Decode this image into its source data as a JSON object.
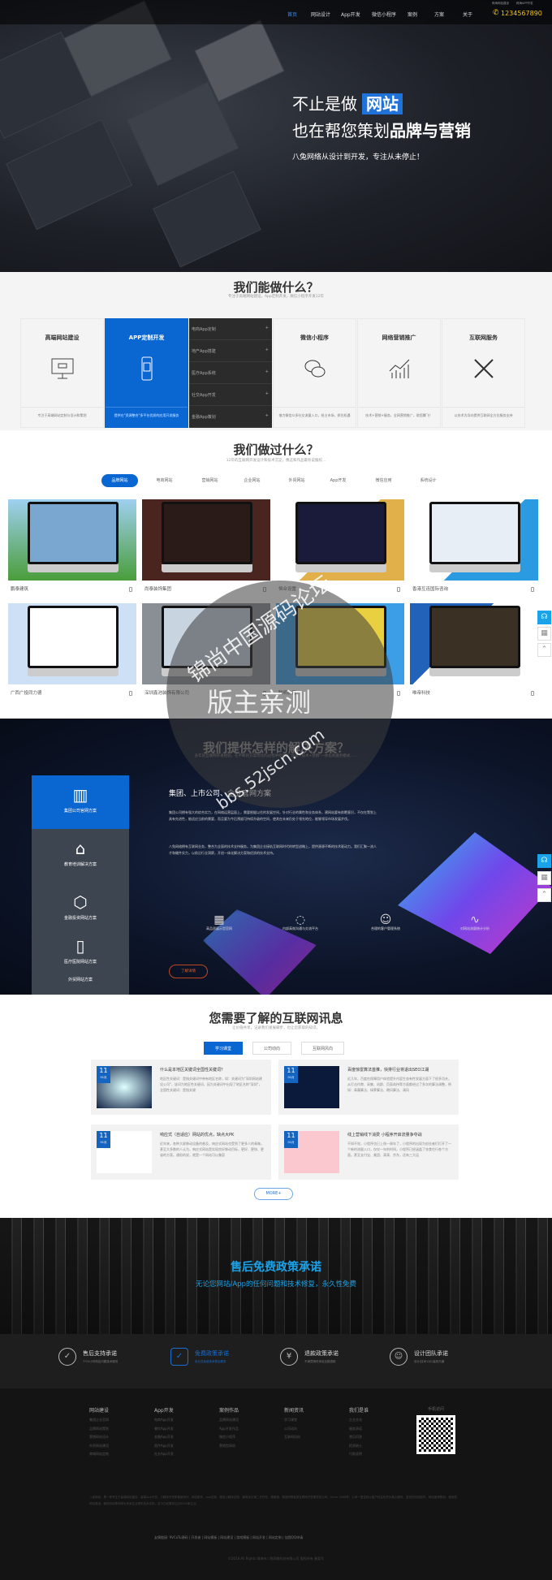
{
  "nav": {
    "items": [
      "首页",
      "网站设计",
      "App开发",
      "微信小程序",
      "案例",
      "方案",
      "关于"
    ],
    "top_links": [
      "珠海网站建设",
      "珠海APP开发"
    ],
    "phone": "1234567890",
    "accent": "#1f73d8"
  },
  "hero": {
    "line1": "不止是做",
    "highlight": "网站",
    "line2_a": "也在帮您策划",
    "line2_b": "品牌与营销",
    "slogan": "八兔网络从设计到开发，专注从未停止！"
  },
  "services": {
    "title": "我们能做什么？",
    "subtitle": "专注于高端网站建设，App定制开发，微信小程序开发12年",
    "items": [
      {
        "title": "高端网站建设",
        "desc": "专注于高端网站定制与设计和策划"
      },
      {
        "title": "APP定制开发",
        "desc": "提供在\"资源整合\"多平台优质的应用开发服务"
      },
      {
        "title": "微信小程序",
        "desc": "借力微信众多社交流量入口，抢占市场，抓住机遇"
      },
      {
        "title": "网络营销推广",
        "desc": "技术+营销+服务，全网营销推广，助您腾飞！"
      },
      {
        "title": "互联网服务",
        "desc": "以技术为导向提供互联网全方位服务支持"
      }
    ],
    "app_menu": [
      "电商App定制",
      "地产App搭建",
      "医疗App系统",
      "社交App开发",
      "金融App策划"
    ]
  },
  "portfolio": {
    "title": "我们做过什么？",
    "subtitle": "12年的互联网开发设计和技术沉淀，像这和作品最有说服权...",
    "tabs": [
      "品牌网站",
      "电商网站",
      "营销网站",
      "企业网站",
      "外贸网站",
      "App开发",
      "微信应用",
      "系统设计"
    ],
    "cases": [
      "鹏泰建筑",
      "尚泰装饰集团",
      "恒众设置",
      "香港互连国际咨询",
      "广西广投同力德",
      "深圳鑫池装饰有限公司",
      "聪明教育",
      "唯帝科技"
    ]
  },
  "solutions": {
    "title": "我们提供怎样的解决方案？",
    "subtitle": "多年的互联网开发经验，在不断的方案优化的过程中搭建了\"创意+技术+营销\"一体化的服务模式……",
    "nav": [
      "集团公司官网方案",
      "教育培训解决方案",
      "金融投资网站方案",
      "医疗医院网站方案",
      "外贸网站方案"
    ],
    "heading": "集团、上市公司、企业官网方案",
    "para1": "集团公司拥有强大的综合实力，在网络运营层面上，需要根据以往的发展空间，针对行业的属性和业务体系，建网站要有前瞻意识，不仅在策划上具有先进性，能适应当前的需要，而且要为今后预留可持续升级的空间，使其在未来仍处于领先地位，能够领导市场发展步伐。",
    "para2": "八兔网络拥有互联网业务，整合为全面的技术支持服务。为集团企业接轨互联网时代的转型战略上，提供源源不断的技术驱动力。我们汇聚一流人才和硬件实力，以前沿行业洞察，开创一体化解决方案和优质的技术支持。",
    "features": [
      "高品质展示型官网",
      "内部高效沟通与交流平台",
      "合理的客户管理系统",
      "对网站流量统计分析"
    ],
    "button": "了解详情",
    "highlight": "#1565c0"
  },
  "news": {
    "title": "您需要了解的互联网讯息",
    "subtitle": "让价值共享，记录我们发展脚步，也让您获取的知识。",
    "tabs": [
      "学习课堂",
      "公司动向",
      "互联网风向"
    ],
    "items": [
      {
        "day": "11",
        "month": "01月",
        "title": "什么是本地区关键词全国性关键词？",
        "text": "地区性关键词：是指关键词中带有地区名称，如：关键词为\"深圳网站建设公司\"，该词为地区性关键词，因为关键词中出现了地区名称\"深圳\"，全国性关键词：是指关键"
      },
      {
        "day": "11",
        "month": "01月",
        "title": "百度惊雷算法首推，快排行业将退出SEO江湖",
        "text": "近几年，百度在保障用户体验提升内容生态有性发展方面下了很多功夫，从打击作弊、采集、站群、页面劫持等方面都经过了多次的算法调整，例如：青藤算法、绿萝算法、飓风算法、清风"
      },
      {
        "day": "11",
        "month": "01月",
        "title": "响应式（自适应）网站的优点，缺点大PK",
        "text": "近年来，各种大屏移动设备的普及，响应式网站也受到了更多人的青睐。甚至大多数的人认为，响应式网站是实现良好移动目标，更好、更快、更省的方案。通俗的说，就是一个网站可以兼容"
      },
      {
        "day": "11",
        "month": "01月",
        "title": "线上营销线下消费 小程序开启流量争夺战",
        "text": "不知不觉，小程序也已上线一周年了，小程序的出现为创业者们打开了一个新的流量入口，仅仅一年的时间，小程序已经涵盖了衣食住行各个方面。甚至支付宝、美团、滴滴、京东，还有三大运"
      }
    ],
    "more": "MORE+"
  },
  "banner": {
    "title": "售后免费政策承诺",
    "subtitle": "无论您网站/App的任何问题和技术修复，永久性免费"
  },
  "promises": [
    {
      "title": "售后支持承诺",
      "desc": "7*24小时响应问题技术服务"
    },
    {
      "title": "免费政策承诺",
      "desc": "永久性免费技术售后服务"
    },
    {
      "title": "退款政策承诺",
      "desc": "不满意随时承诺全额退款"
    },
    {
      "title": "设计团队承诺",
      "desc": "设计/技术1对1高效沟通"
    }
  ],
  "footer": {
    "columns": [
      {
        "title": "网站建设",
        "links": [
          "集团企业官网",
          "品牌网站策划",
          "营销网站设计",
          "外贸网站建设",
          "商城网站定制"
        ]
      },
      {
        "title": "App开发",
        "links": [
          "电商App开发",
          "餐饮App开发",
          "金融App开发",
          "医疗App开发",
          "社交App开发"
        ]
      },
      {
        "title": "案例作品",
        "links": [
          "品牌网站建设",
          "App开发作品",
          "微信小程序",
          "营销型网站"
        ]
      },
      {
        "title": "新闻资讯",
        "links": [
          "学习课堂",
          "公司动向",
          "互联网风向"
        ]
      },
      {
        "title": "我们是谁",
        "links": [
          "企业文化",
          "服务承诺",
          "常见问答",
          "招贤纳士",
          "付款说明"
        ]
      }
    ],
    "qr_title": "手机访问",
    "about": "八兔网络，是一家专注于高端网站建设、高端App开发、小程序开发和营销设计、网站制作、app定制、微信小程序定制、微商及分销二次开发、微营销、微官网等各类互联网开发服务的公司。Since 2006年，公司一直坚持以客户利益优先为核心服务，坚持在网站制作、网站营销策划、营销型网站建设、微信网站等领域为多家企业提供技术支持，至今已经服务过近5000家企业。",
    "links_label": "友情链接:",
    "links": [
      "9VCaTu源码",
      "开发者",
      "网站模板",
      "网站建设",
      "游戏模板",
      "网站开发",
      "网站定制",
      "加我QQ申请"
    ],
    "copyright": "©2018 All Rights 珠海市八兔网络科技有限公司 版权所有 备案号"
  },
  "watermark": {
    "line1": "锦尚中国源码论坛",
    "line2": "版主亲测",
    "url": "bbs.52jscn.com"
  }
}
